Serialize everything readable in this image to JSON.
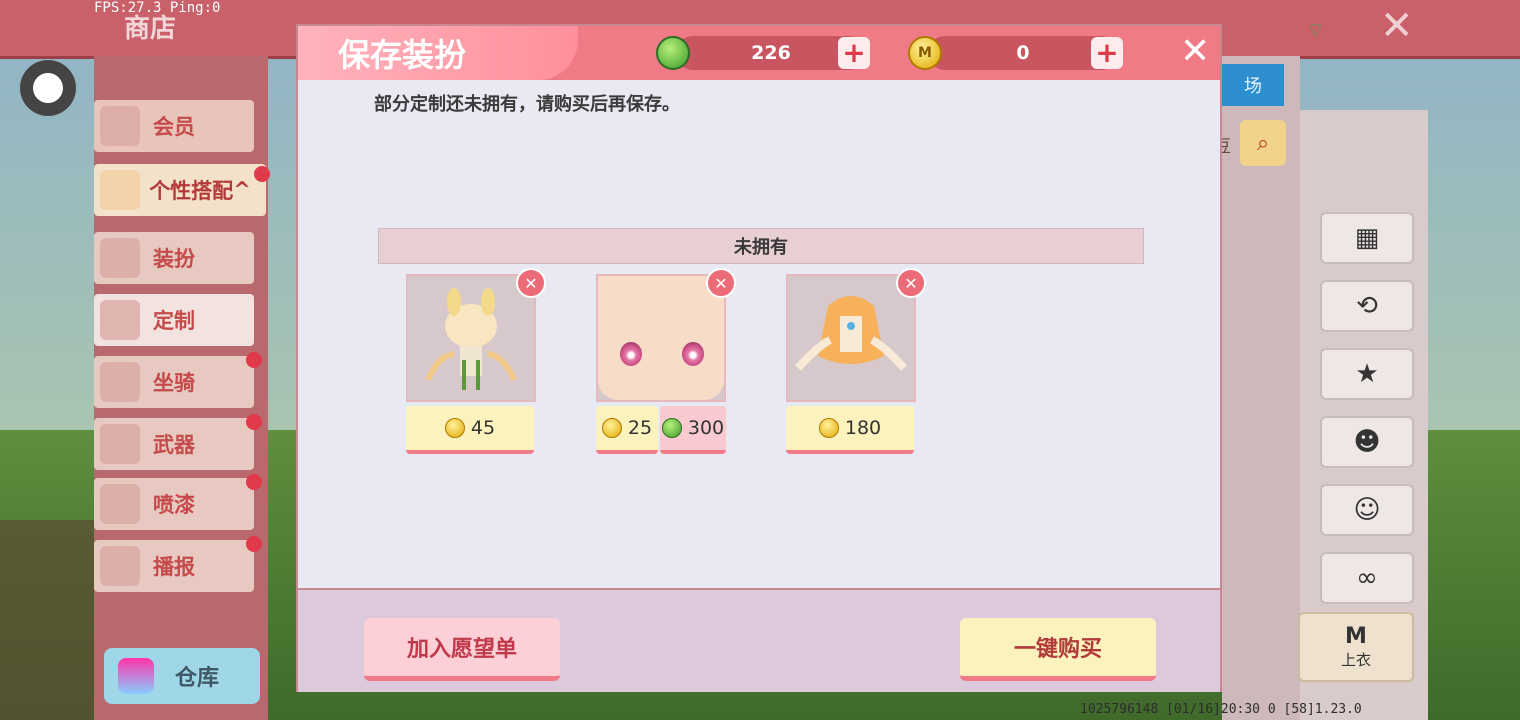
{
  "hud": {
    "fps_text": "FPS:27.3  Ping:0"
  },
  "store": {
    "title": "商店",
    "tab_partial": "场",
    "bean_partial": "豆"
  },
  "sidebar": {
    "items": [
      {
        "label": "会员",
        "dot": false
      },
      {
        "label": "个性搭配",
        "arrow": "^",
        "dot": true
      },
      {
        "label": "装扮",
        "dot": false
      },
      {
        "label": "定制",
        "dot": false
      },
      {
        "label": "坐骑",
        "dot": true
      },
      {
        "label": "武器",
        "dot": true
      },
      {
        "label": "喷漆",
        "dot": true
      },
      {
        "label": "播报",
        "dot": true
      }
    ],
    "warehouse_label": "仓库"
  },
  "right_panel": {
    "icons": [
      "grid-icon",
      "history-icon",
      "outfit-icon",
      "hair-icon",
      "face-icon",
      "mask-icon"
    ],
    "top_clothes_label": "上衣",
    "top_clothes_mark": "M"
  },
  "dialog": {
    "title": "保存装扮",
    "green_currency": "226",
    "gold_currency": "0",
    "message": "部分定制还未拥有，请购买后再保存。",
    "section_title": "未拥有",
    "items": [
      {
        "name": "hair-item",
        "prices": [
          {
            "currency": "gold",
            "value": "45"
          }
        ]
      },
      {
        "name": "face-item",
        "prices": [
          {
            "currency": "gold",
            "value": "25"
          },
          {
            "currency": "green",
            "value": "300"
          }
        ]
      },
      {
        "name": "dress-item",
        "prices": [
          {
            "currency": "gold",
            "value": "180"
          }
        ]
      }
    ],
    "wishlist_button": "加入愿望单",
    "buy_all_button": "一键购买"
  },
  "status_bar": {
    "text": "1025796148    [01/16]20:30 0    [58]1.23.0"
  }
}
